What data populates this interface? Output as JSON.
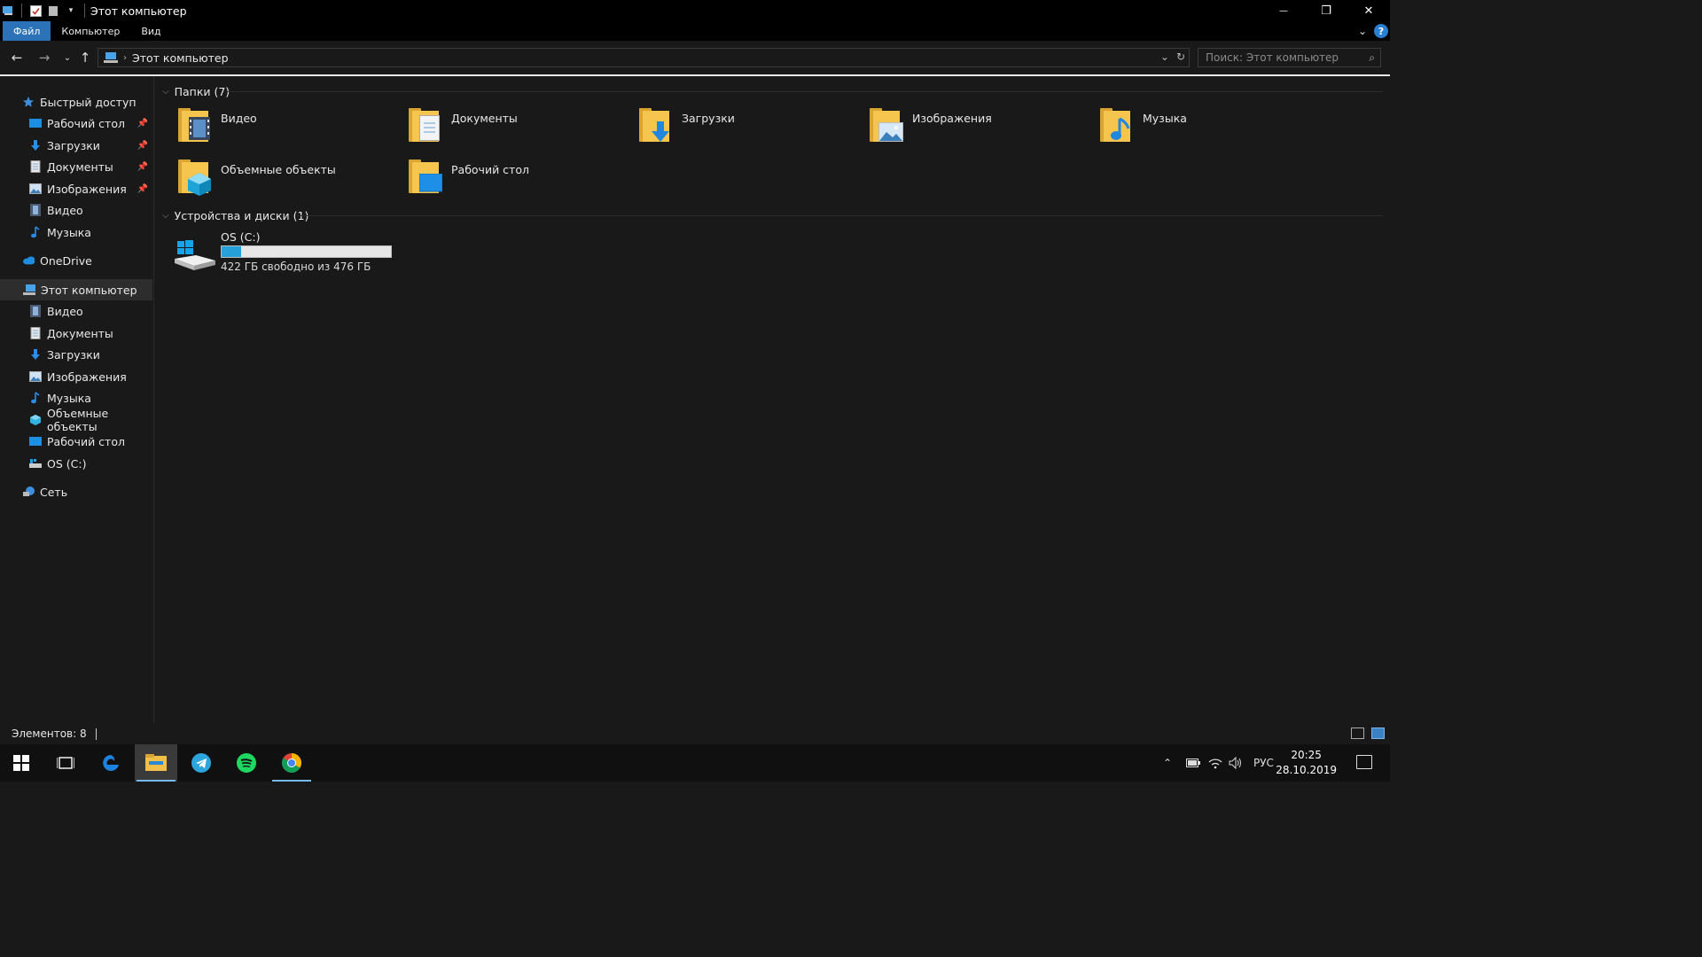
{
  "window": {
    "title": "Этот компьютер",
    "controls": {
      "minimize": "—",
      "restore": "❐",
      "close": "✕"
    }
  },
  "ribbon": {
    "tabs": [
      "Файл",
      "Компьютер",
      "Вид"
    ],
    "active_tab": "Файл"
  },
  "address": {
    "path": "Этот компьютер",
    "search_placeholder": "Поиск: Этот компьютер"
  },
  "nav": {
    "quick_access": "Быстрый доступ",
    "quick_items": [
      {
        "label": "Рабочий стол",
        "icon": "desktop-icon",
        "pinned": true
      },
      {
        "label": "Загрузки",
        "icon": "downloads-icon",
        "pinned": true
      },
      {
        "label": "Документы",
        "icon": "documents-icon",
        "pinned": true
      },
      {
        "label": "Изображения",
        "icon": "pictures-icon",
        "pinned": true
      },
      {
        "label": "Видео",
        "icon": "video-icon",
        "pinned": false
      },
      {
        "label": "Музыка",
        "icon": "music-icon",
        "pinned": false
      }
    ],
    "onedrive": "OneDrive",
    "this_pc": "Этот компьютер",
    "pc_items": [
      {
        "label": "Видео",
        "icon": "video-icon"
      },
      {
        "label": "Документы",
        "icon": "documents-icon"
      },
      {
        "label": "Загрузки",
        "icon": "downloads-icon"
      },
      {
        "label": "Изображения",
        "icon": "pictures-icon"
      },
      {
        "label": "Музыка",
        "icon": "music-icon"
      },
      {
        "label": "Объемные объекты",
        "icon": "3d-objects-icon"
      },
      {
        "label": "Рабочий стол",
        "icon": "desktop-icon"
      },
      {
        "label": "OS (C:)",
        "icon": "drive-icon"
      }
    ],
    "network": "Сеть"
  },
  "main": {
    "folders_header": "Папки (7)",
    "folders": [
      {
        "label": "Видео",
        "icon": "video-folder-icon"
      },
      {
        "label": "Документы",
        "icon": "documents-folder-icon"
      },
      {
        "label": "Загрузки",
        "icon": "downloads-folder-icon"
      },
      {
        "label": "Изображения",
        "icon": "pictures-folder-icon"
      },
      {
        "label": "Музыка",
        "icon": "music-folder-icon"
      },
      {
        "label": "Объемные объекты",
        "icon": "3d-objects-folder-icon"
      },
      {
        "label": "Рабочий стол",
        "icon": "desktop-folder-icon"
      }
    ],
    "devices_header": "Устройства и диски (1)",
    "drive": {
      "label": "OS (C:)",
      "free_text": "422 ГБ свободно из 476 ГБ",
      "used_fraction": 0.113
    }
  },
  "status": {
    "items_text": "Элементов: 8"
  },
  "taskbar": {
    "apps": [
      "start-icon",
      "task-view-icon",
      "edge-icon",
      "file-explorer-icon",
      "telegram-icon",
      "spotify-icon",
      "chrome-icon"
    ],
    "language": "РУС",
    "time": "20:25",
    "date": "28.10.2019"
  },
  "colors": {
    "accent": "#2b72b9",
    "folder": "#f5c54e",
    "drive_fill": "#26a0da"
  }
}
